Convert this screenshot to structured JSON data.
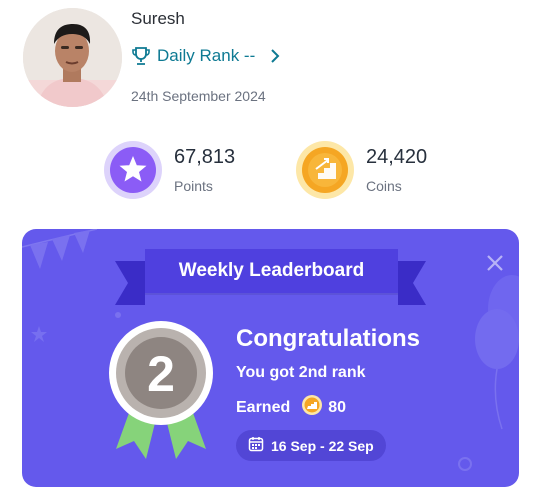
{
  "profile": {
    "name": "Suresh",
    "daily_rank_label": "Daily Rank --",
    "date": "24th September 2024"
  },
  "stats": {
    "points": {
      "value": "67,813",
      "label": "Points",
      "icon": "star-icon"
    },
    "coins": {
      "value": "24,420",
      "label": "Coins",
      "icon": "coin-icon"
    }
  },
  "leaderboard_card": {
    "banner": "Weekly Leaderboard",
    "medal_number": "2",
    "title": "Congratulations",
    "rank_text": "You got 2nd rank",
    "earned_label": "Earned",
    "earned_value": "80",
    "date_range": "16 Sep - 22 Sep"
  },
  "colors": {
    "card_bg": "#6459ec",
    "banner_bg": "#4f40df",
    "rank_link": "#0e7a93",
    "points_icon": "#8b5cf6",
    "coins_icon": "#f59e0b"
  }
}
